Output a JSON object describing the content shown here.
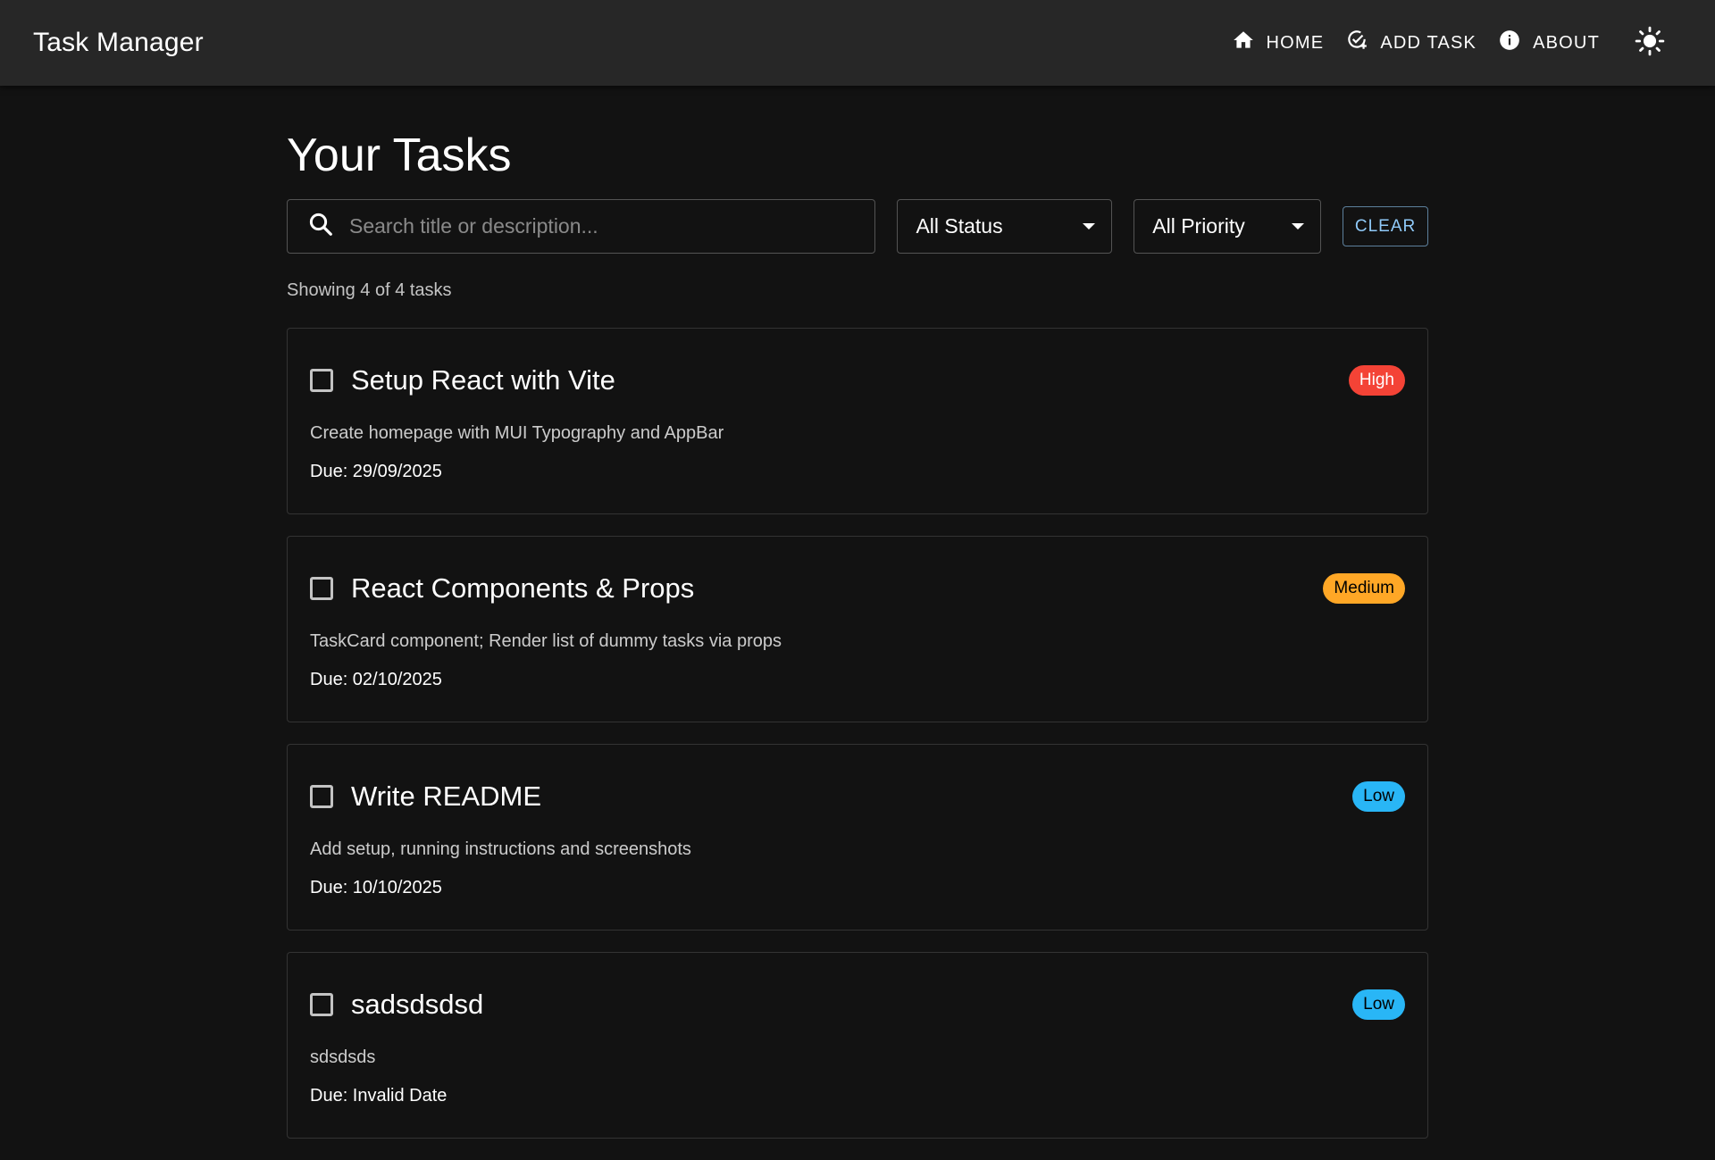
{
  "appbar": {
    "title": "Task Manager",
    "nav": [
      {
        "label": "Home",
        "icon": "home-icon"
      },
      {
        "label": "Add Task",
        "icon": "add-task-icon"
      },
      {
        "label": "About",
        "icon": "info-icon"
      }
    ],
    "theme_icon": "sun-icon"
  },
  "page": {
    "title": "Your Tasks",
    "search": {
      "placeholder": "Search title or description...",
      "value": ""
    },
    "status_filter": "All Status",
    "priority_filter": "All Priority",
    "clear_label": "Clear",
    "count_text": "Showing 4 of 4 tasks"
  },
  "tasks": [
    {
      "title": "Setup React with Vite",
      "description": "Create homepage with MUI Typography and AppBar",
      "due": "Due: 29/09/2025",
      "priority": "High",
      "completed": false
    },
    {
      "title": "React Components & Props",
      "description": "TaskCard component; Render list of dummy tasks via props",
      "due": "Due: 02/10/2025",
      "priority": "Medium",
      "completed": false
    },
    {
      "title": "Write README",
      "description": "Add setup, running instructions and screenshots",
      "due": "Due: 10/10/2025",
      "priority": "Low",
      "completed": false
    },
    {
      "title": "sadsdsdsd",
      "description": "sdsdsds",
      "due": "Due: Invalid Date",
      "priority": "Low",
      "completed": false
    }
  ],
  "colors": {
    "background": "#121212",
    "appbar": "#272727",
    "accent": "#90caf9",
    "high": "#f44336",
    "medium": "#ffa726",
    "low": "#29b6f6"
  }
}
